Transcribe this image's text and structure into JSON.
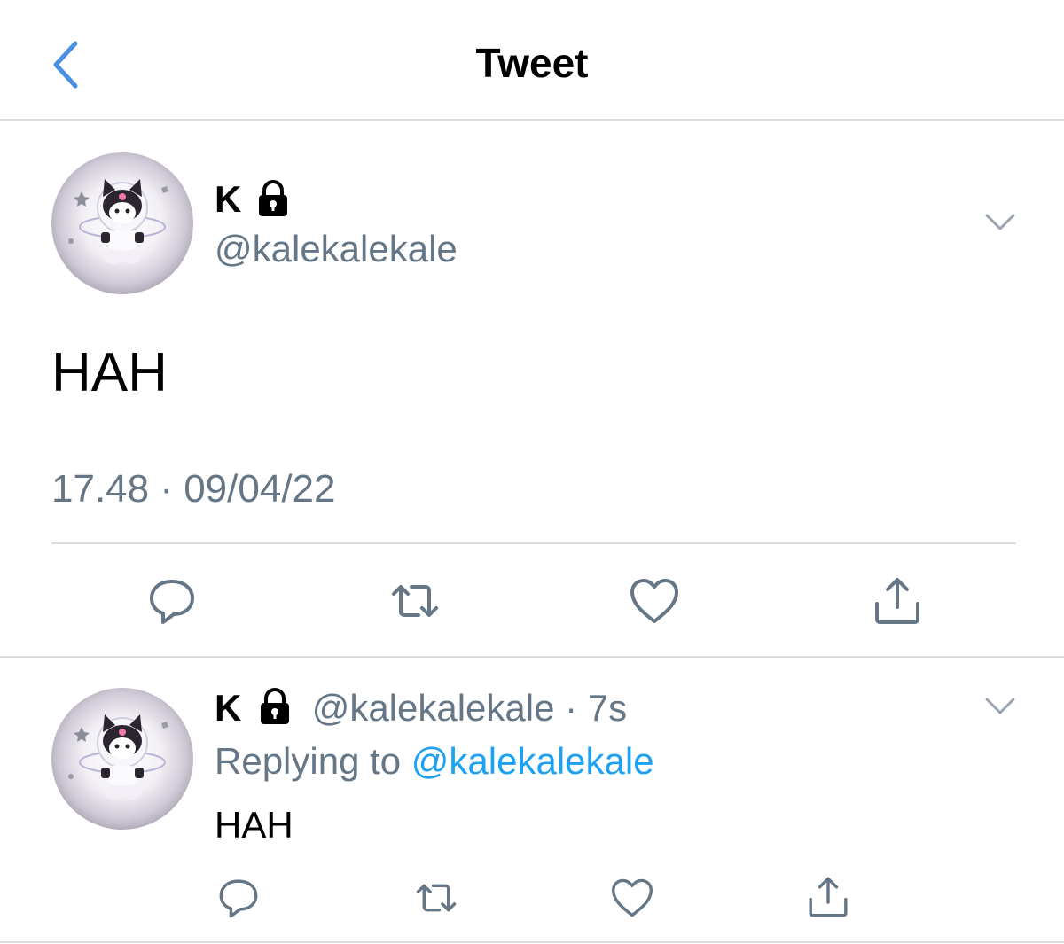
{
  "header": {
    "title": "Tweet",
    "back_icon": "chevron-left-icon",
    "accent": "#4a90e2"
  },
  "main_tweet": {
    "author_name": "K",
    "locked_icon": "lock-icon",
    "handle": "@kalekalekale",
    "text": "HAH",
    "timestamp": "17.48 · 09/04/22",
    "actions": [
      "reply-icon",
      "retweet-icon",
      "like-icon",
      "share-icon"
    ]
  },
  "reply_tweet": {
    "author_name": "K",
    "handle": "@kalekalekale",
    "separator": "·",
    "time_ago": "7s",
    "replying_label": "Replying to",
    "replying_handle": "@kalekalekale",
    "text": "HAH",
    "actions": [
      "reply-icon",
      "retweet-icon",
      "like-icon",
      "share-icon"
    ]
  },
  "colors": {
    "link": "#1da1f2",
    "muted": "#657786",
    "icon": "#657786",
    "divider": "#dcdfe2"
  }
}
